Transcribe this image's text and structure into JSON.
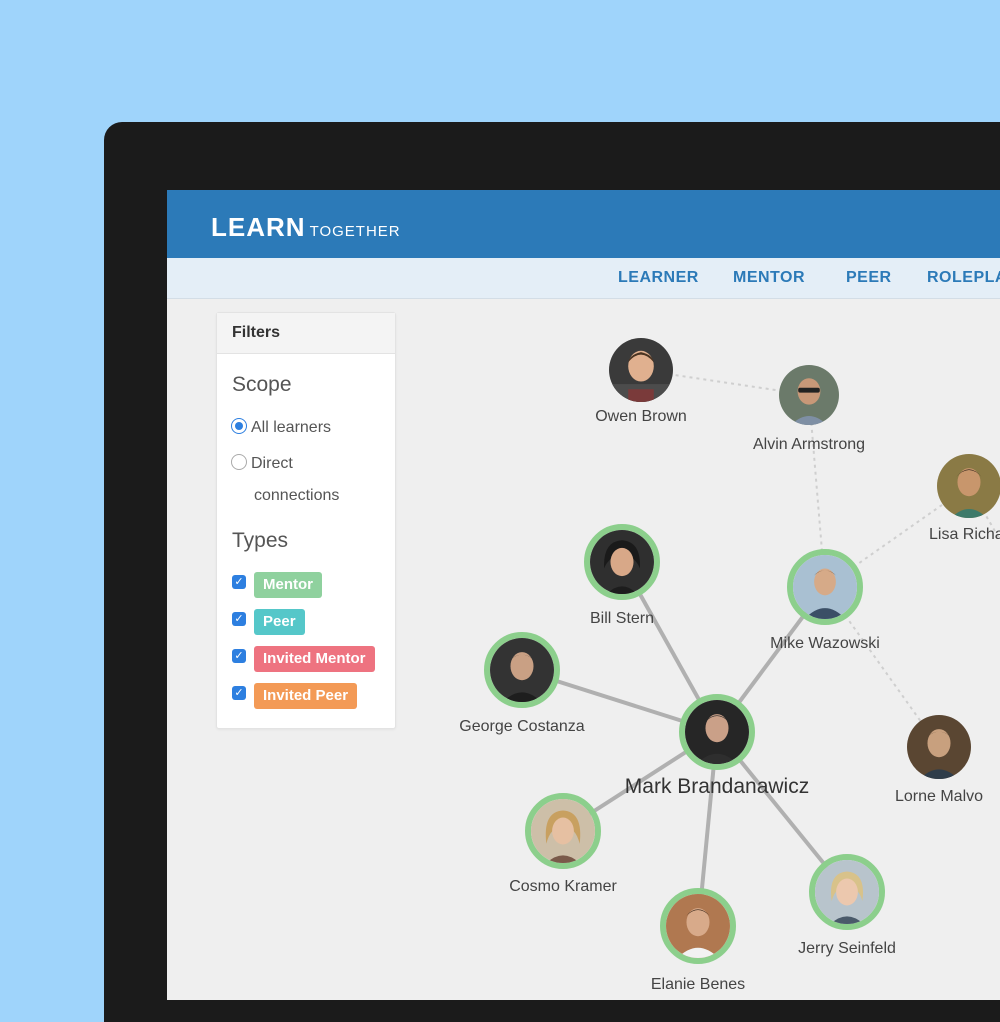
{
  "app": {
    "logo_main": "LEARN",
    "logo_sub": "TOGETHER"
  },
  "nav": {
    "tabs": [
      "LEARNER",
      "MENTOR",
      "PEER",
      "ROLEPLA"
    ]
  },
  "filters": {
    "title": "Filters",
    "scope_title": "Scope",
    "scope_options": [
      "All learners",
      "Direct",
      "connections"
    ],
    "types_title": "Types",
    "types": [
      {
        "label": "Mentor",
        "color": "#8fd19e",
        "checked": true
      },
      {
        "label": "Peer",
        "color": "#55c7c9",
        "checked": true
      },
      {
        "label": "Invited Mentor",
        "color": "#ee7380",
        "checked": true
      },
      {
        "label": "Invited Peer",
        "color": "#f39a56",
        "checked": true
      }
    ]
  },
  "graph": {
    "people": [
      "Owen Brown",
      "Alvin Armstrong",
      "Lisa Richar",
      "Bill Stern",
      "Mike Wazowski",
      "George Costanza",
      "Mark Brandanawicz",
      "Lorne Malvo",
      "Cosmo Kramer",
      "Jerry Seinfeld",
      "Elanie Benes"
    ]
  },
  "colors": {
    "accent": "#2c7ab8",
    "node_ring": "#8ccf8c",
    "solid_edge": "#b0b0b0",
    "dotted_edge": "#cfcfcf"
  }
}
